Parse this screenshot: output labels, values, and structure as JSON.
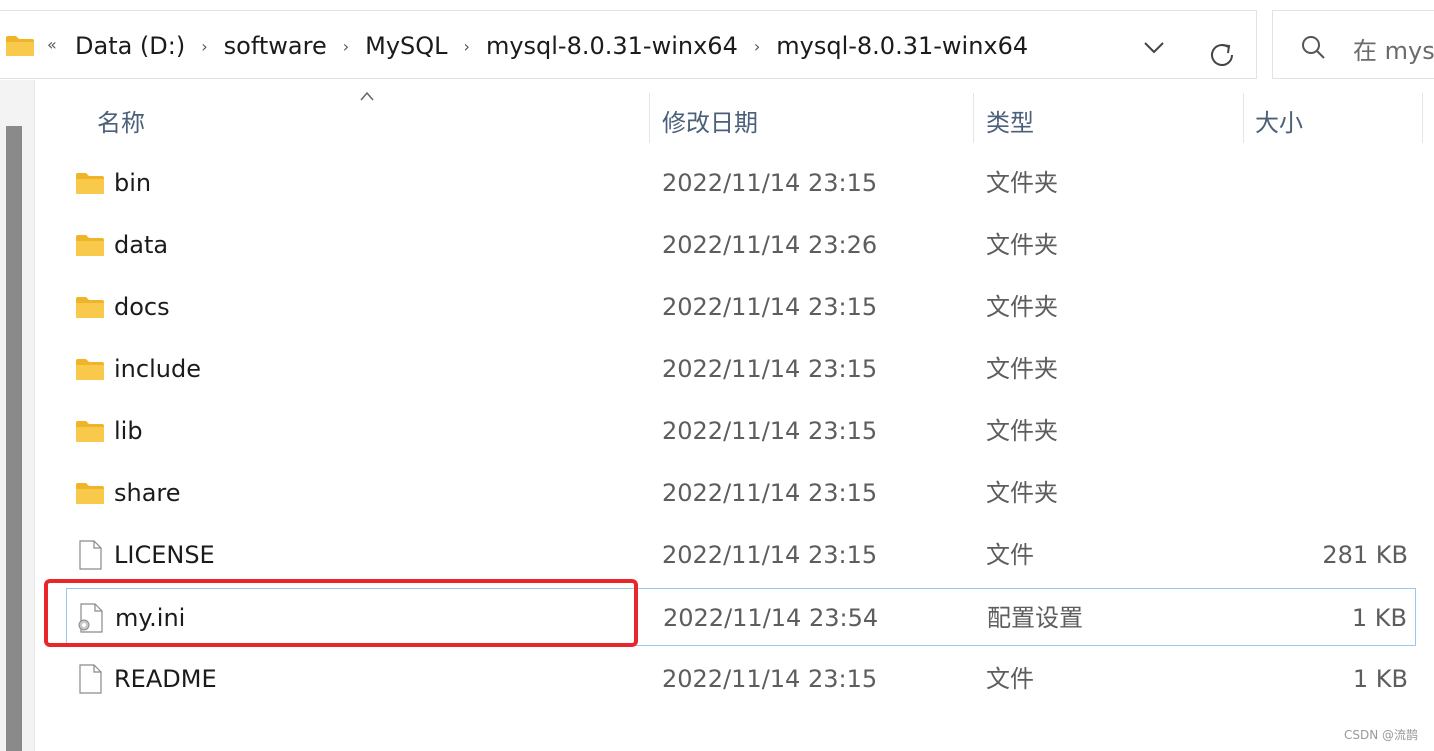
{
  "address_bar": {
    "overflow": "«",
    "crumbs": [
      "Data (D:)",
      "software",
      "MySQL",
      "mysql-8.0.31-winx64",
      "mysql-8.0.31-winx64"
    ],
    "separator": "›"
  },
  "search": {
    "text": "在 mys"
  },
  "columns": {
    "name": "名称",
    "date": "修改日期",
    "type": "类型",
    "size": "大小"
  },
  "rows": [
    {
      "name": "bin",
      "date": "2022/11/14 23:15",
      "type": "文件夹",
      "size": "",
      "icon": "folder-icon"
    },
    {
      "name": "data",
      "date": "2022/11/14 23:26",
      "type": "文件夹",
      "size": "",
      "icon": "folder-icon"
    },
    {
      "name": "docs",
      "date": "2022/11/14 23:15",
      "type": "文件夹",
      "size": "",
      "icon": "folder-icon"
    },
    {
      "name": "include",
      "date": "2022/11/14 23:15",
      "type": "文件夹",
      "size": "",
      "icon": "folder-icon"
    },
    {
      "name": "lib",
      "date": "2022/11/14 23:15",
      "type": "文件夹",
      "size": "",
      "icon": "folder-icon"
    },
    {
      "name": "share",
      "date": "2022/11/14 23:15",
      "type": "文件夹",
      "size": "",
      "icon": "folder-icon"
    },
    {
      "name": "LICENSE",
      "date": "2022/11/14 23:15",
      "type": "文件",
      "size": "281 KB",
      "icon": "file-icon"
    },
    {
      "name": "my.ini",
      "date": "2022/11/14 23:54",
      "type": "配置设置",
      "size": "1 KB",
      "icon": "config-file-icon",
      "selected": true
    },
    {
      "name": "README",
      "date": "2022/11/14 23:15",
      "type": "文件",
      "size": "1 KB",
      "icon": "file-icon"
    }
  ],
  "watermark": "CSDN @流鹊",
  "colors": {
    "header_text": "#4c607a",
    "selection_border": "#99c9ef",
    "highlight_red": "#e8262b",
    "folder_yellow": "#f8c94a"
  }
}
